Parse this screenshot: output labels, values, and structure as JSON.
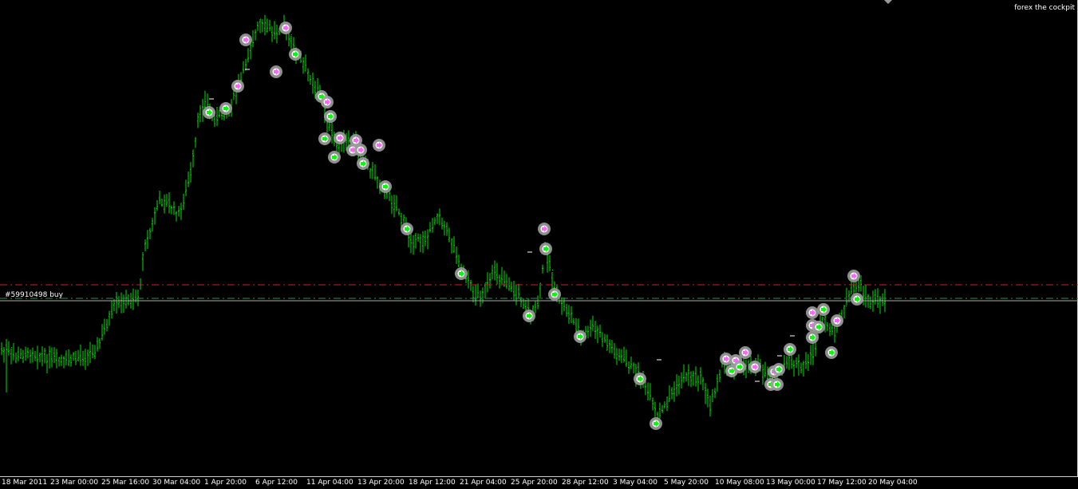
{
  "chart": {
    "watermark": "forex the cockpit",
    "trade_label": "#59910498 buy"
  },
  "colors": {
    "background": "#000000",
    "bars": "#00e000",
    "trade_line": "#a9a9a9",
    "stop_line": "#d02020",
    "target_line": "#2e8b57",
    "order_marker_buy": "#00ff00",
    "order_marker_sell": "#ff66ff",
    "order_halo": "#9c9c9c",
    "axis": "#cfcfcf",
    "text": "#ffffff"
  },
  "chart_data": {
    "type": "ohlc",
    "title": "",
    "xlabel": "",
    "ylabel": "",
    "grid": false,
    "legend": "none",
    "x_tick_labels": [
      "18 Mar 2011",
      "23 Mar 00:00",
      "25 Mar 16:00",
      "30 Mar 04:00",
      "1 Apr 20:00",
      "6 Apr 12:00",
      "11 Apr 04:00",
      "13 Apr 20:00",
      "18 Apr 12:00",
      "21 Apr 04:00",
      "25 Apr 20:00",
      "28 Apr 12:00",
      "3 May 04:00",
      "5 May 20:00",
      "10 May 08:00",
      "13 May 00:00",
      "17 May 12:00",
      "20 May 04:00"
    ],
    "price_shape": [
      [
        0,
        440
      ],
      [
        8,
        440
      ],
      [
        20,
        448
      ],
      [
        40,
        442
      ],
      [
        60,
        450
      ],
      [
        80,
        453
      ],
      [
        100,
        447
      ],
      [
        120,
        440
      ],
      [
        135,
        405
      ],
      [
        145,
        382
      ],
      [
        165,
        377
      ],
      [
        175,
        370
      ],
      [
        180,
        310
      ],
      [
        190,
        285
      ],
      [
        200,
        250
      ],
      [
        215,
        260
      ],
      [
        225,
        270
      ],
      [
        240,
        215
      ],
      [
        250,
        140
      ],
      [
        258,
        128
      ],
      [
        270,
        150
      ],
      [
        285,
        140
      ],
      [
        300,
        105
      ],
      [
        312,
        65
      ],
      [
        325,
        30
      ],
      [
        345,
        40
      ],
      [
        355,
        30
      ],
      [
        370,
        65
      ],
      [
        385,
        90
      ],
      [
        400,
        115
      ],
      [
        410,
        150
      ],
      [
        420,
        180
      ],
      [
        445,
        180
      ],
      [
        460,
        205
      ],
      [
        480,
        235
      ],
      [
        500,
        265
      ],
      [
        515,
        300
      ],
      [
        535,
        300
      ],
      [
        550,
        265
      ],
      [
        565,
        300
      ],
      [
        580,
        340
      ],
      [
        595,
        370
      ],
      [
        605,
        368
      ],
      [
        620,
        340
      ],
      [
        635,
        355
      ],
      [
        650,
        370
      ],
      [
        665,
        395
      ],
      [
        675,
        380
      ],
      [
        683,
        312
      ],
      [
        688,
        330
      ],
      [
        700,
        375
      ],
      [
        715,
        395
      ],
      [
        728,
        422
      ],
      [
        745,
        410
      ],
      [
        760,
        430
      ],
      [
        780,
        450
      ],
      [
        802,
        470
      ],
      [
        815,
        500
      ],
      [
        825,
        525
      ],
      [
        840,
        495
      ],
      [
        860,
        470
      ],
      [
        880,
        475
      ],
      [
        890,
        510
      ],
      [
        905,
        455
      ],
      [
        925,
        460
      ],
      [
        945,
        455
      ],
      [
        960,
        470
      ],
      [
        975,
        470
      ],
      [
        990,
        450
      ],
      [
        1005,
        465
      ],
      [
        1020,
        440
      ],
      [
        1030,
        400
      ],
      [
        1045,
        420
      ],
      [
        1060,
        380
      ],
      [
        1075,
        355
      ],
      [
        1090,
        380
      ],
      [
        1110,
        375
      ]
    ],
    "trade_lines": {
      "buy_entry": "#59910498 buy"
    },
    "order_markers": [
      [
        262,
        141,
        "b"
      ],
      [
        283,
        136,
        "b"
      ],
      [
        298,
        108,
        "s"
      ],
      [
        308,
        50,
        "s"
      ],
      [
        346,
        90,
        "s"
      ],
      [
        358,
        35,
        "s"
      ],
      [
        370,
        68,
        "b"
      ],
      [
        403,
        121,
        "b"
      ],
      [
        410,
        128,
        "s"
      ],
      [
        414,
        146,
        "b"
      ],
      [
        407,
        174,
        "b"
      ],
      [
        419,
        197,
        "b"
      ],
      [
        426,
        173,
        "s"
      ],
      [
        442,
        188,
        "s"
      ],
      [
        446,
        176,
        "s"
      ],
      [
        452,
        188,
        "s"
      ],
      [
        455,
        205,
        "b"
      ],
      [
        475,
        182,
        "s"
      ],
      [
        483,
        234,
        "b"
      ],
      [
        510,
        287,
        "b"
      ],
      [
        578,
        343,
        "b"
      ],
      [
        663,
        396,
        "b"
      ],
      [
        682,
        287,
        "s"
      ],
      [
        684,
        312,
        "b"
      ],
      [
        695,
        369,
        "b"
      ],
      [
        727,
        422,
        "b"
      ],
      [
        802,
        475,
        "b"
      ],
      [
        822,
        531,
        "b"
      ],
      [
        910,
        450,
        "s"
      ],
      [
        917,
        465,
        "b"
      ],
      [
        922,
        452,
        "s"
      ],
      [
        927,
        460,
        "b"
      ],
      [
        934,
        442,
        "s"
      ],
      [
        946,
        460,
        "s"
      ],
      [
        966,
        482,
        "b"
      ],
      [
        970,
        466,
        "s"
      ],
      [
        974,
        482,
        "b"
      ],
      [
        976,
        463,
        "b"
      ],
      [
        990,
        438,
        "b"
      ],
      [
        1018,
        392,
        "s"
      ],
      [
        1018,
        423,
        "b"
      ],
      [
        1018,
        408,
        "s"
      ],
      [
        1026,
        410,
        "b"
      ],
      [
        1032,
        388,
        "b"
      ],
      [
        1042,
        442,
        "b"
      ],
      [
        1049,
        402,
        "s"
      ],
      [
        1070,
        346,
        "s"
      ],
      [
        1074,
        375,
        "b"
      ]
    ],
    "pending_dashes": [
      [
        265,
        124
      ],
      [
        310,
        87
      ],
      [
        664,
        316
      ],
      [
        826,
        451
      ],
      [
        949,
        478
      ],
      [
        977,
        446
      ],
      [
        993,
        421
      ]
    ]
  }
}
